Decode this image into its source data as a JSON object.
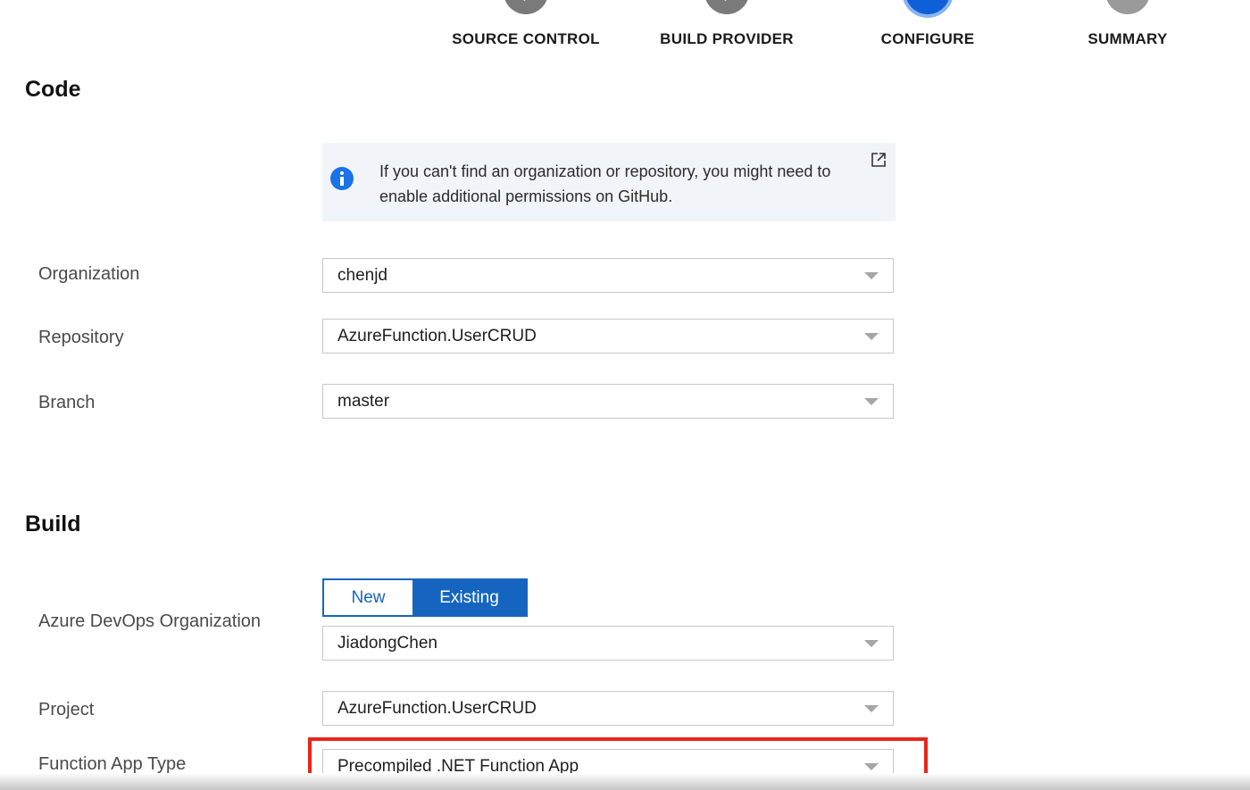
{
  "stepper": {
    "steps": [
      {
        "label": "SOURCE CONTROL",
        "state": "done"
      },
      {
        "label": "BUILD PROVIDER",
        "state": "done"
      },
      {
        "label": "CONFIGURE",
        "state": "current"
      },
      {
        "label": "SUMMARY",
        "state": "pending"
      }
    ]
  },
  "code": {
    "title": "Code",
    "info_text": "If you can't find an organization or repository, you might need to enable additional permissions on GitHub.",
    "organization": {
      "label": "Organization",
      "value": "chenjd"
    },
    "repository": {
      "label": "Repository",
      "value": "AzureFunction.UserCRUD"
    },
    "branch": {
      "label": "Branch",
      "value": "master"
    }
  },
  "build": {
    "title": "Build",
    "devops_org": {
      "label": "Azure DevOps Organization",
      "toggle_new": "New",
      "toggle_existing": "Existing",
      "selected_toggle": "Existing",
      "value": "JiadongChen"
    },
    "project": {
      "label": "Project",
      "value": "AzureFunction.UserCRUD"
    },
    "function_app_type": {
      "label": "Function App Type",
      "value": "Precompiled .NET Function App"
    }
  },
  "colors": {
    "accent": "#1565c0",
    "highlight": "#e8261b",
    "info_bg": "#f1f5fa"
  }
}
